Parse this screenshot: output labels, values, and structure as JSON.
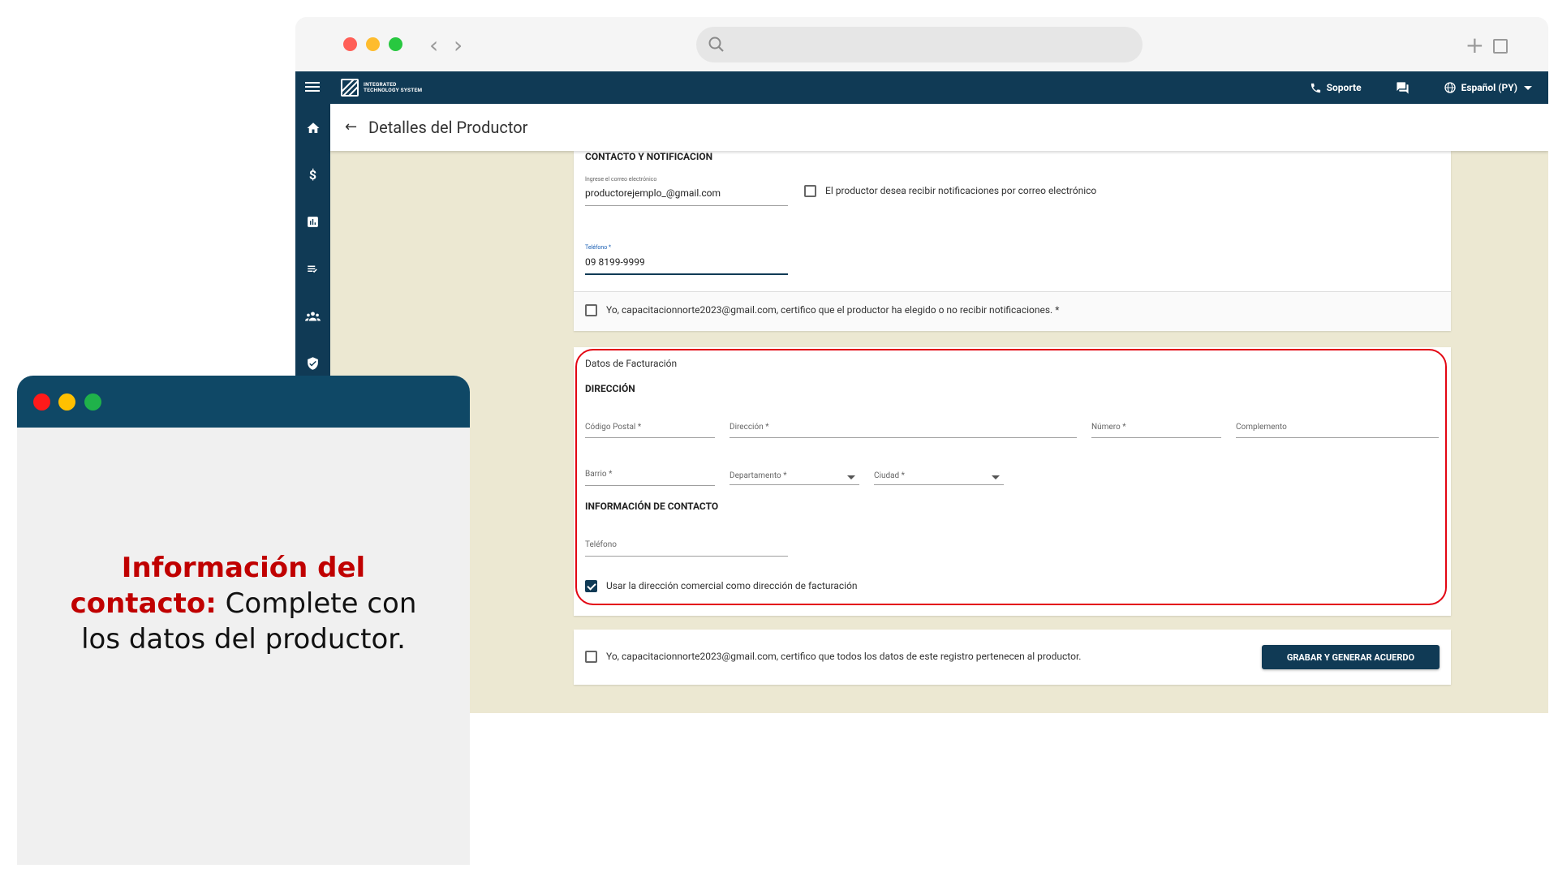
{
  "app": {
    "brand": "INTEGRATED TECHNOLOGY SYSTEM",
    "brand_line1": "INTEGRATED",
    "brand_line2": "TECHNOLOGY SYSTEM",
    "support_label": "Soporte",
    "language_label": "Español (PY)",
    "page_title": "Detalles del Productor"
  },
  "contacto": {
    "section_title": "CONTACTO Y NOTIFICACION",
    "email_label": "Ingrese el correo electrónico",
    "email_value": "productorejemplo_@gmail.com",
    "email_notify_label": "El productor desea recibir notificaciones por correo electrónico",
    "email_notify_checked": false,
    "phone_label": "Teléfono *",
    "phone_value": "09 8199-9999",
    "certify_notifications": "Yo, capacitacionnorte2023@gmail.com, certifico que el productor ha elegido o no recibir notificaciones. *",
    "certify_notifications_checked": false
  },
  "facturacion": {
    "card_title": "Datos de Facturación",
    "direccion_title": "DIRECCIÓN",
    "codigo_postal_label": "Código Postal *",
    "direccion_label": "Dirección *",
    "numero_label": "Número *",
    "complemento_label": "Complemento",
    "barrio_label": "Barrio *",
    "departamento_label": "Departamento *",
    "ciudad_label": "Ciudad *",
    "contacto_title": "INFORMACIÓN DE CONTACTO",
    "telefono_label": "Teléfono",
    "use_commercial_label": "Usar la dirección comercial como dirección de facturación",
    "use_commercial_checked": true
  },
  "footer": {
    "certify_data": "Yo, capacitacionnorte2023@gmail.com, certifico que todos los datos de este registro pertenecen al productor.",
    "certify_data_checked": false,
    "submit_label": "GRABAR Y GENERAR ACUERDO"
  },
  "info_panel": {
    "highlight_text": "Información del contacto:",
    "body_text": " Complete con los datos del productor."
  },
  "colors": {
    "navy": "#103a55",
    "highlight_red": "#e30613",
    "info_red": "#c00000",
    "background_beige": "#ece8d2"
  }
}
